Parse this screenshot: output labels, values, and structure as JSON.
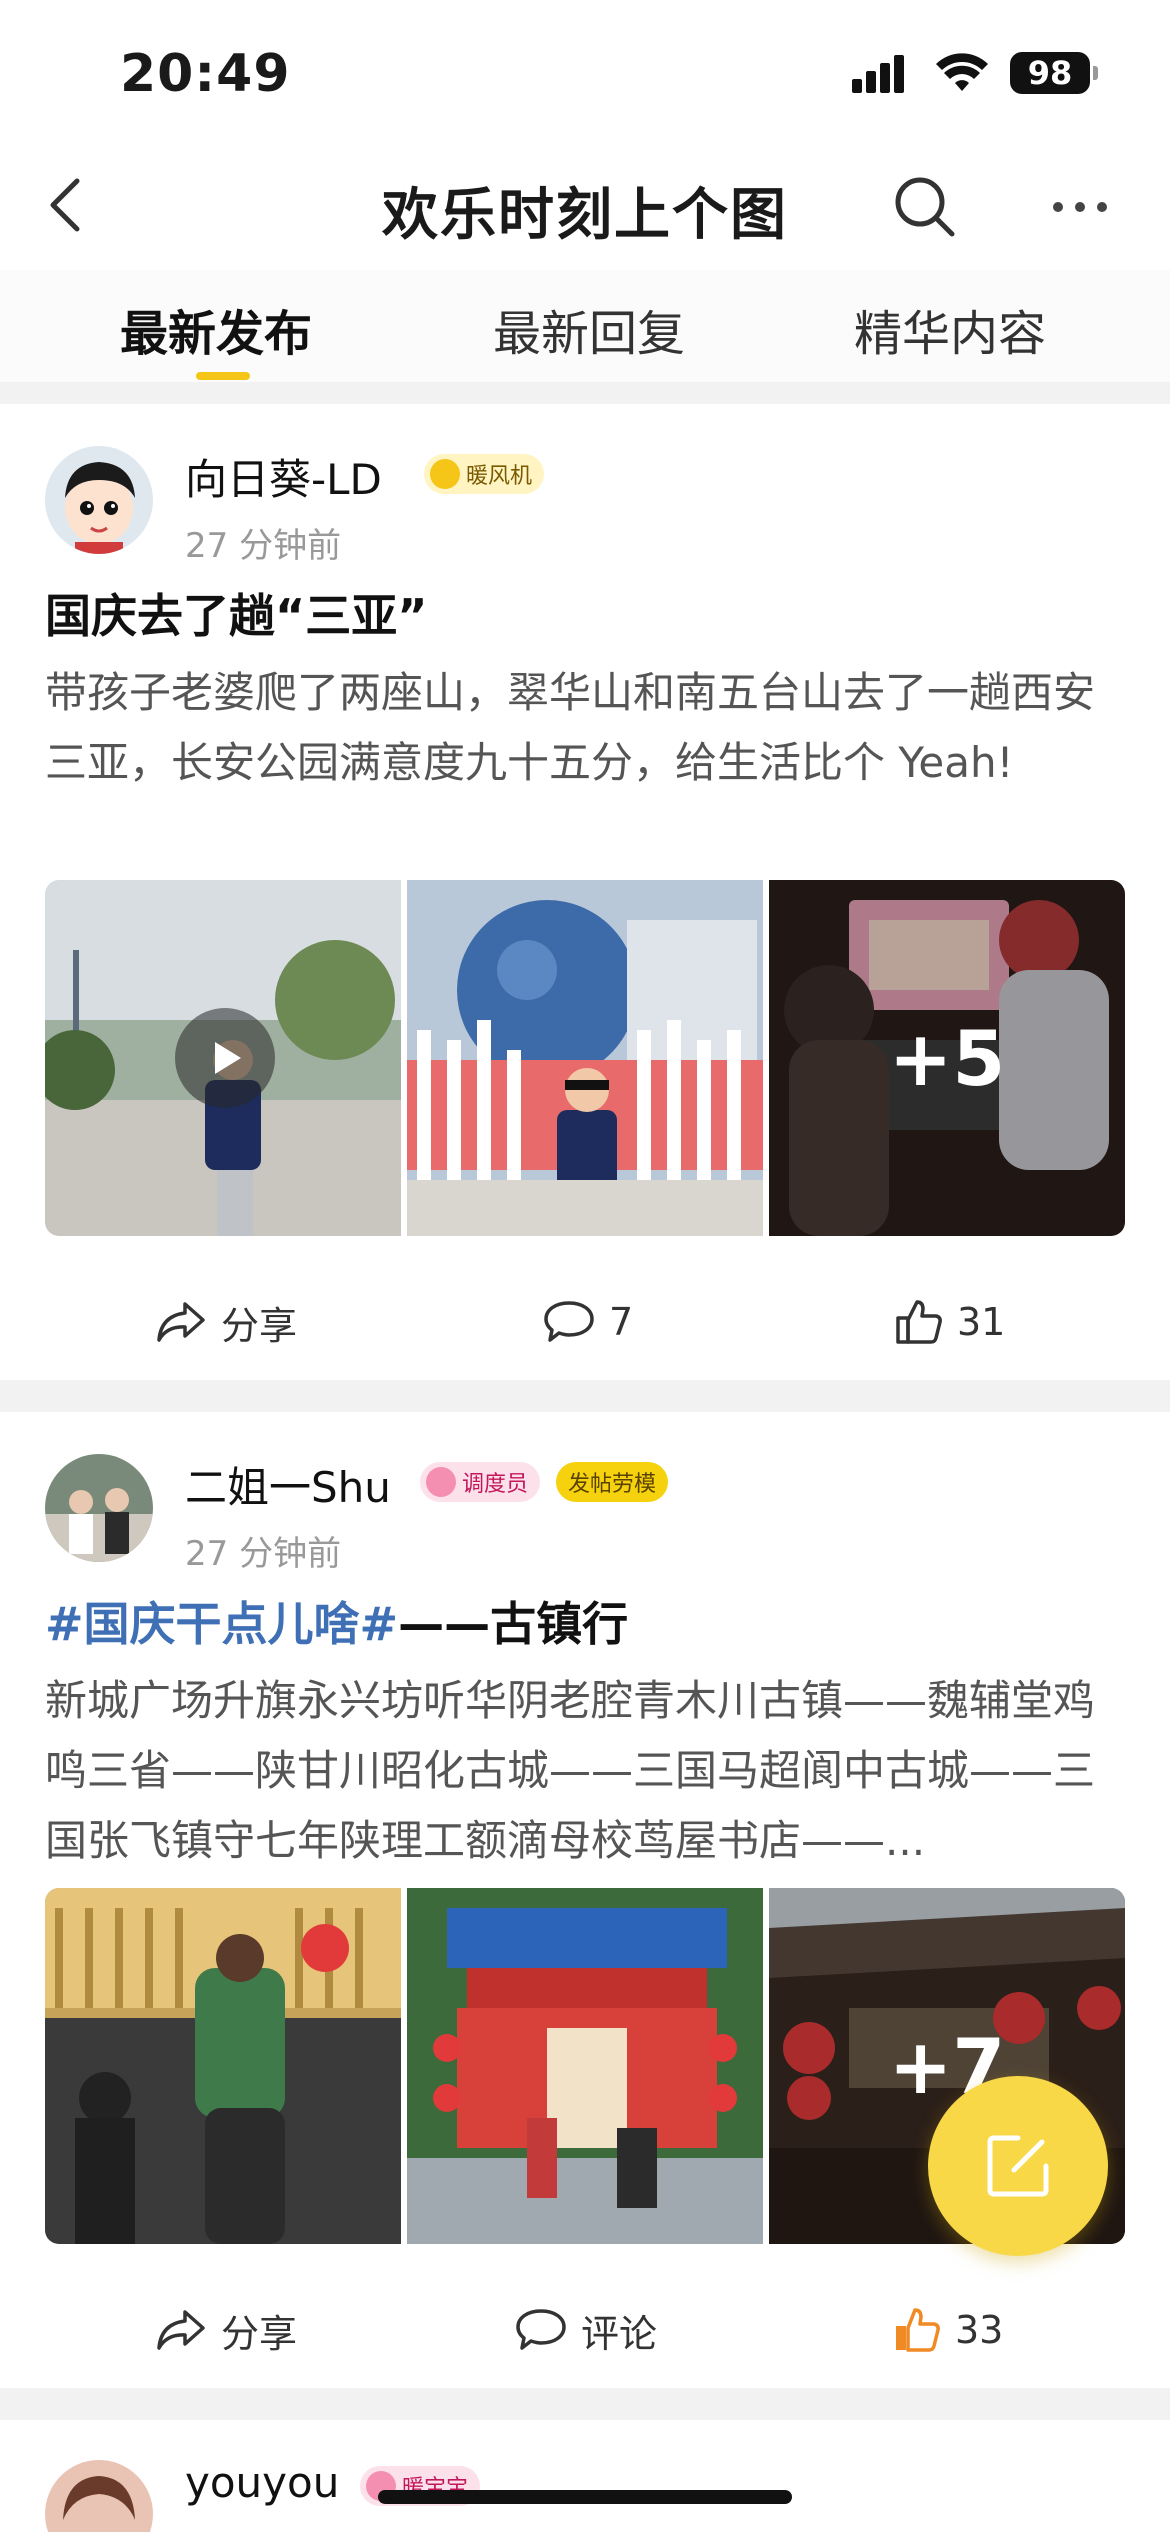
{
  "status_bar": {
    "time": "20:49",
    "battery": "98"
  },
  "nav": {
    "title": "欢乐时刻上个图"
  },
  "tabs": [
    {
      "label": "最新发布",
      "active": true
    },
    {
      "label": "最新回复",
      "active": false
    },
    {
      "label": "精华内容",
      "active": false
    }
  ],
  "posts": [
    {
      "username": "向日葵-LD",
      "badges": [
        {
          "label": "暖风机",
          "color": "#f5c518"
        }
      ],
      "time": "27 分钟前",
      "title": "国庆去了趟“三亚”",
      "topic": "",
      "body": "带孩子老婆爬了两座山，翠华山和南五台山去了一趟西安三亚，长安公园满意度九十五分，给生活比个 Yeah!",
      "more_images": "+5",
      "actions": {
        "share": "分享",
        "comments": "7",
        "likes": "31"
      }
    },
    {
      "username": "二姐一Shu",
      "badges": [
        {
          "label": "调度员",
          "color": "#f48fb1"
        },
        {
          "label": "发帖劳模",
          "color": "#f5d20d"
        }
      ],
      "time": "27 分钟前",
      "topic": "#国庆干点儿啥#",
      "title": "——古镇行",
      "body": "新城广场升旗永兴坊听华阴老腔青木川古镇——魏辅堂鸡鸣三省——陕甘川昭化古城——三国马超阆中古城——三国张飞镇守七年陕理工额滴母校茑屋书店——...",
      "more_images": "+7",
      "actions": {
        "share": "分享",
        "comments": "评论",
        "likes": "33"
      }
    },
    {
      "username": "youyou",
      "badges": [
        {
          "label": "暖宝宝",
          "color": "#f48fb1"
        }
      ]
    }
  ],
  "colors": {
    "accent": "#f5c518",
    "topic": "#3f6fb5",
    "fab": "#f8d847",
    "liked": "#f08a24"
  }
}
